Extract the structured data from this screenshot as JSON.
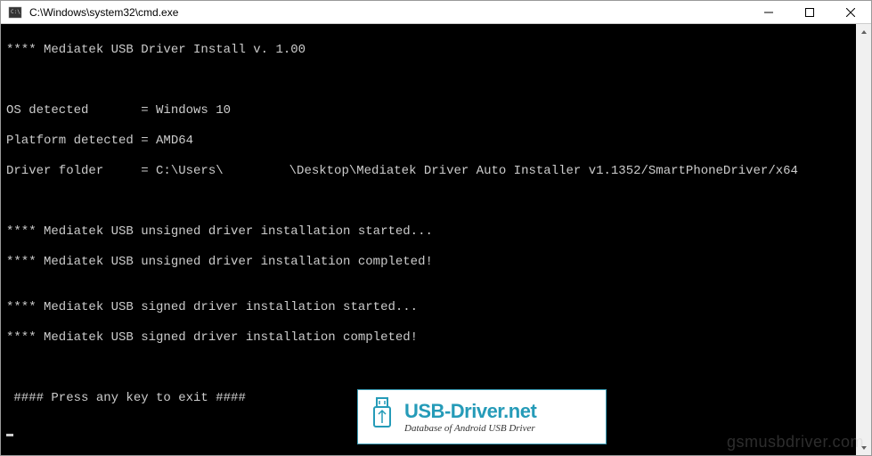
{
  "window": {
    "title": "C:\\Windows\\system32\\cmd.exe"
  },
  "terminal": {
    "lines": [
      "**** Mediatek USB Driver Install v. 1.00",
      "",
      "",
      "OS detected       = Windows 10",
      "Platform detected = AMD64",
      "Driver folder     = C:\\Users\\          \\Desktop\\Mediatek Driver Auto Installer v1.1352/SmartPhoneDriver/x64",
      "",
      "",
      "**** Mediatek USB unsigned driver installation started...",
      "**** Mediatek USB unsigned driver installation completed!",
      "",
      "**** Mediatek USB signed driver installation started...",
      "**** Mediatek USB signed driver installation completed!",
      "",
      "",
      " #### Press any key to exit ####"
    ],
    "driver_folder_prefix": "Driver folder     = C:\\Users\\",
    "driver_folder_suffix": "\\Desktop\\Mediatek Driver Auto Installer v1.1352/SmartPhoneDriver/x64"
  },
  "logo": {
    "title": "USB-Driver.net",
    "subtitle": "Database of Android USB Driver"
  },
  "watermark": "gsmusbdriver.com"
}
